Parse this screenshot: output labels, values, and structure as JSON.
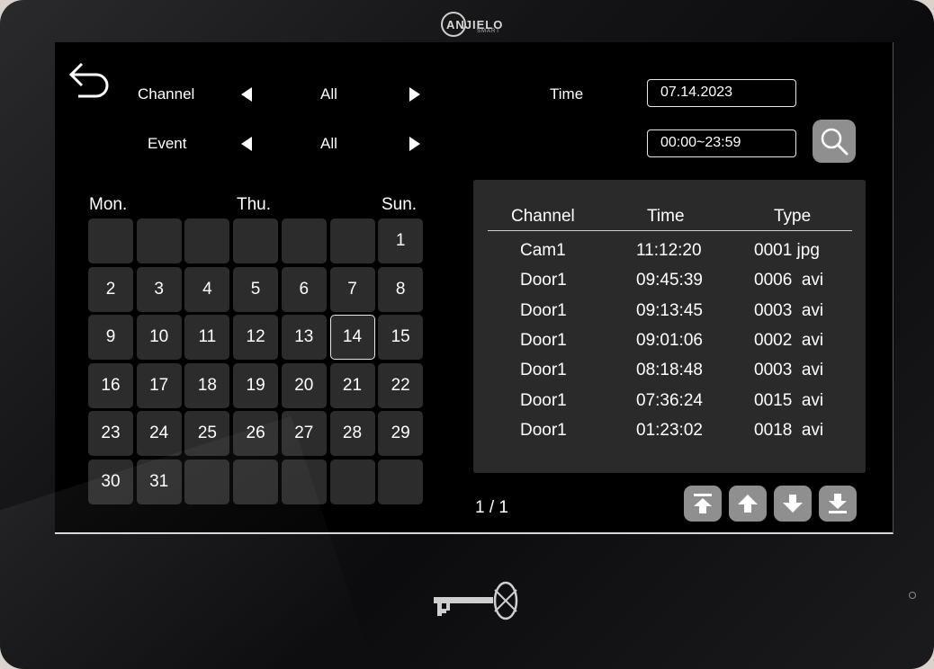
{
  "brand": {
    "name": "ANJIELO",
    "sub": "SMART"
  },
  "filters": {
    "channel_label": "Channel",
    "channel_value": "All",
    "event_label": "Event",
    "event_value": "All",
    "time_label": "Time",
    "date_value": "07.14.2023",
    "time_range_value": "00:00~23:59"
  },
  "calendar": {
    "headers": [
      "Mon.",
      "Thu.",
      "Sun."
    ],
    "selected_day": "14",
    "weeks": [
      [
        "",
        "",
        "",
        "",
        "",
        "",
        "1"
      ],
      [
        "2",
        "3",
        "4",
        "5",
        "6",
        "7",
        "8"
      ],
      [
        "9",
        "10",
        "11",
        "12",
        "13",
        "14",
        "15"
      ],
      [
        "16",
        "17",
        "18",
        "19",
        "20",
        "21",
        "22"
      ],
      [
        "23",
        "24",
        "25",
        "26",
        "27",
        "28",
        "29"
      ],
      [
        "30",
        "31",
        "",
        "",
        "",
        "",
        ""
      ]
    ]
  },
  "records": {
    "columns": [
      "Channel",
      "Time",
      "Type"
    ],
    "rows": [
      [
        "Cam1",
        "11:12:20",
        "0001 jpg"
      ],
      [
        "Door1",
        "09:45:39",
        "0006  avi"
      ],
      [
        "Door1",
        "09:13:45",
        "0003  avi"
      ],
      [
        "Door1",
        "09:01:06",
        "0002  avi"
      ],
      [
        "Door1",
        "08:18:48",
        "0003  avi"
      ],
      [
        "Door1",
        "07:36:24",
        "0015  avi"
      ],
      [
        "Door1",
        "01:23:02",
        "0018  avi"
      ]
    ]
  },
  "pager": {
    "text": "1 / 1"
  },
  "colors": {
    "screen": "#000000",
    "cell": "#2c2c2c",
    "panel": "#2a2a2a",
    "button": "#8f8f8f",
    "text": "#ffffff"
  }
}
